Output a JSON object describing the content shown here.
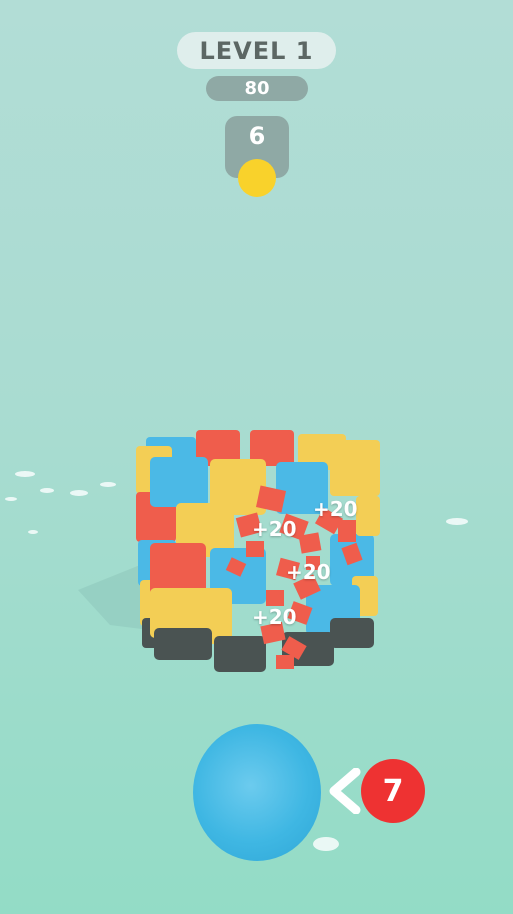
{
  "hud": {
    "level_label": "LEVEL 1",
    "score": "80",
    "shots_remaining": "6",
    "ammo_count": "7"
  },
  "floating_scores": [
    "+20",
    "+20",
    "+20",
    "+20"
  ],
  "colors": {
    "red": "#ef5d4c",
    "blue": "#4bb9e6",
    "yellow": "#f3ce55",
    "dark": "#4a5352",
    "coin": "#f9d22b",
    "badge": "#ee3232"
  }
}
